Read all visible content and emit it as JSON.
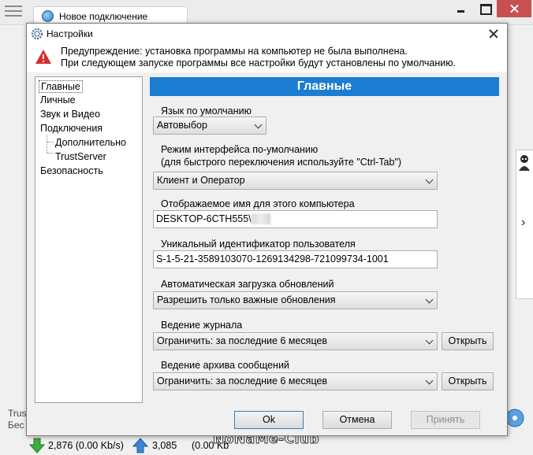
{
  "background_app": {
    "tab_label": "Новое подключение",
    "left_text_1": "Trus",
    "left_text_2": "Бес",
    "download_stat": "2,876 (0.00 Kb/s)",
    "upload_stat": "3,085",
    "upload_stat_2": "(0.00 Kb",
    "watermark": "NoNaMe-Club"
  },
  "dialog": {
    "title": "Настройки",
    "warning_line_1": "Предупреждение: установка программы на компьютер не была выполнена.",
    "warning_line_2": "При следующем запуске программы все настройки будут установлены по умолчанию.",
    "tree": {
      "items": [
        {
          "label": "Главные",
          "selected": true
        },
        {
          "label": "Личные"
        },
        {
          "label": "Звук и Видео"
        },
        {
          "label": "Подключения"
        },
        {
          "label": "Дополнительно"
        },
        {
          "label": "TrustServer"
        },
        {
          "label": "Безопасность"
        }
      ]
    },
    "panel_title": "Главные",
    "fields": {
      "language_label": "Язык по умолчанию",
      "language_value": "Автовыбор",
      "mode_label_1": "Режим интерфейса по-умолчанию",
      "mode_label_2": "(для быстрого переключения используйте \"Ctrl-Tab\")",
      "mode_value": "Клиент и Оператор",
      "display_name_label": "Отображаемое имя для этого компьютера",
      "display_name_value": "DESKTOP-6CTH555\\",
      "uid_label": "Уникальный идентификатор пользователя",
      "uid_value": "S-1-5-21-3589103070-1269134298-721099734-1001",
      "updates_label": "Автоматическая загрузка обновлений",
      "updates_value": "Разрешить только важные обновления",
      "log_label": "Ведение журнала",
      "log_value": "Ограничить: за последние 6 месяцев",
      "log_open": "Открыть",
      "archive_label": "Ведение архива сообщений",
      "archive_value": "Ограничить: за последние 6 месяцев",
      "archive_open": "Открыть"
    },
    "buttons": {
      "ok": "Ok",
      "cancel": "Отмена",
      "apply": "Принять"
    }
  },
  "colors": {
    "header_blue": "#1a7dd2",
    "close_red": "#c75050",
    "warning_red": "#d32f2f"
  }
}
